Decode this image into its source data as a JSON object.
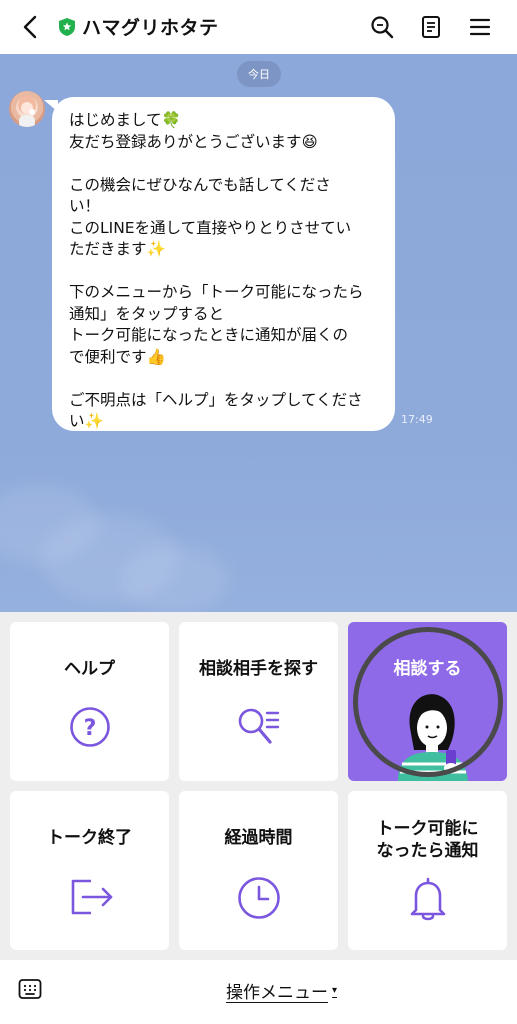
{
  "header": {
    "title": "ハマグリホタテ",
    "icons": [
      "back-arrow-icon",
      "shield-icon",
      "search-icon",
      "notes-icon",
      "menu-icon"
    ]
  },
  "chat": {
    "date_label": "今日",
    "message": {
      "text": "はじめまして🍀\n友だち登録ありがとうございます😆\n\nこの機会にぜひなんでも話してくださ\nい！\nこのLINEを通して直接やりとりさせてい\nただきます✨\n\n下のメニューから「トーク可能になったら\n通知」をタップすると\nトーク可能になったときに通知が届くの\nで便利です👍\n\nご不明点は「ヘルプ」をタップしてくださ\nい✨",
      "time": "17:49"
    }
  },
  "rich_menu": {
    "items": [
      {
        "label": "ヘルプ",
        "icon": "help-icon"
      },
      {
        "label": "相談相手を探す",
        "icon": "search-list-icon"
      },
      {
        "label": "相談する",
        "icon": "woman-illustration"
      },
      {
        "label": "トーク終了",
        "icon": "exit-icon"
      },
      {
        "label": "経過時間",
        "icon": "clock-icon"
      },
      {
        "label": "トーク可能に\nなったら通知",
        "icon": "bell-icon"
      }
    ]
  },
  "bottom_bar": {
    "menu_label": "操作メニュー",
    "caret": "▾"
  },
  "colors": {
    "chat_background": "#8eaadb",
    "accent_purple": "#7b56de",
    "featured_tile": "#8f6ae8",
    "shield_green": "#22b14c"
  }
}
